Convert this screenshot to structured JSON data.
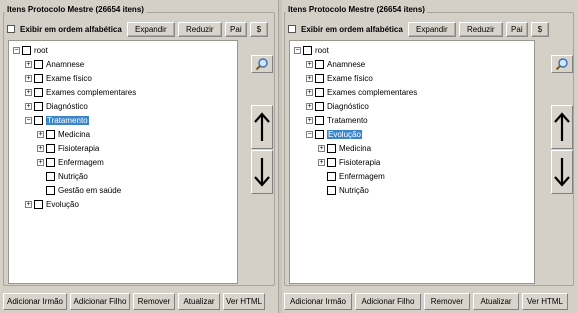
{
  "left": {
    "title": "Itens Protocolo Mestre (26654 itens)",
    "alphabetical_label": "Exibir em ordem alfabética",
    "toolbar": {
      "expand": "Expandir",
      "reduce": "Reduzir",
      "parent": "Pai",
      "dollar": "$"
    },
    "tree": {
      "root": "root",
      "items": [
        "Anamnese",
        "Exame físico",
        "Exames complementares",
        "Diagnóstico",
        "Tratamento",
        "Medicina",
        "Fisioterapia",
        "Enfermagem",
        "Nutrição",
        "Gestão em saúde",
        "Evolução"
      ]
    },
    "bottom": {
      "add_sibling": "Adicionar Irmão",
      "add_child": "Adicionar Filho",
      "remove": "Remover",
      "update": "Atualizar",
      "view_html": "Ver HTML"
    }
  },
  "right": {
    "title": "Itens Protocolo Mestre (26654 itens)",
    "alphabetical_label": "Exibir em ordem alfabética",
    "toolbar": {
      "expand": "Expandir",
      "reduce": "Reduzir",
      "parent": "Pai",
      "dollar": "$"
    },
    "tree": {
      "root": "root",
      "items": [
        "Anamnese",
        "Exame físico",
        "Exames complementares",
        "Diagnóstico",
        "Tratamento",
        "Evolução",
        "Medicina",
        "Fisioterapia",
        "Enfermagem",
        "Nutrição"
      ]
    },
    "bottom": {
      "add_sibling": "Adicionar Irmão",
      "add_child": "Adicionar Filho",
      "remove": "Remover",
      "update": "Atualizar",
      "view_html": "Ver HTML"
    }
  },
  "colors": {
    "selection": "#3a86c8",
    "background": "#d4d0c8"
  },
  "icons": {
    "search": "magnifier-icon",
    "up": "arrow-up-icon",
    "down": "arrow-down-icon"
  }
}
